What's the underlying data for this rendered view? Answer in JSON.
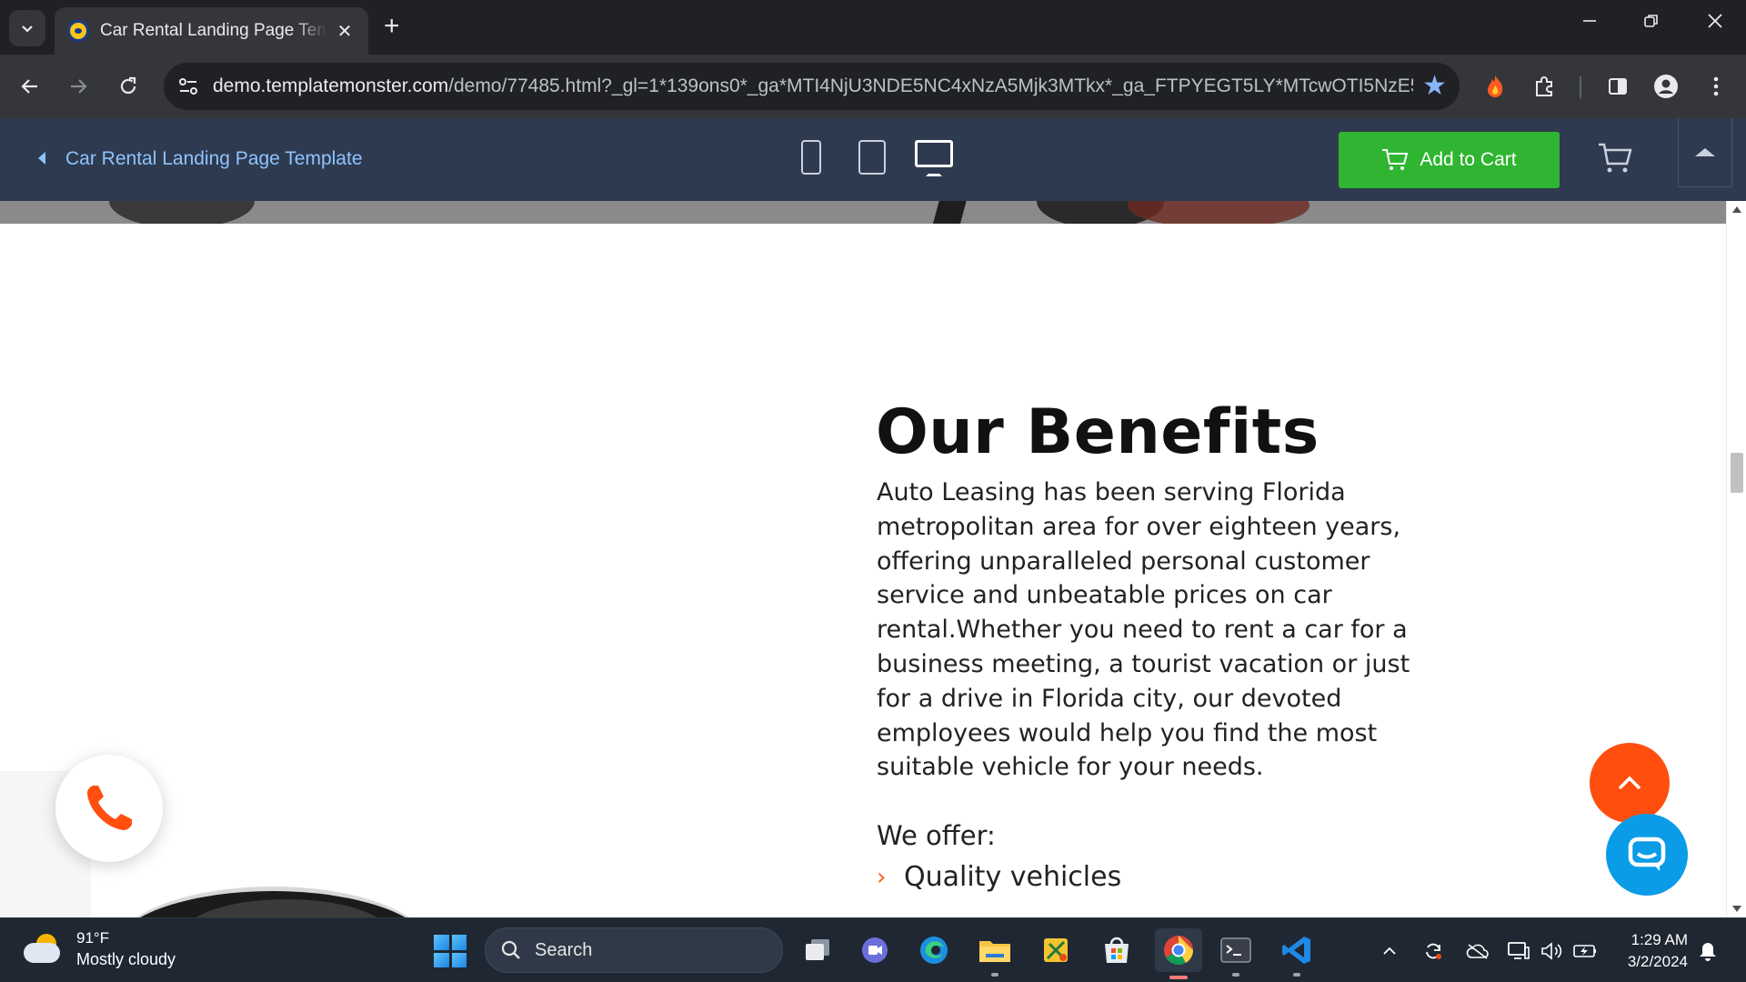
{
  "browser": {
    "tab_title": "Car Rental Landing Page Template",
    "tab_close": "✕",
    "new_tab": "+",
    "url_domain": "demo.templatemonster.com",
    "url_path": "/demo/77485.html?_gl=1*139ons0*_ga*MTI4NjU3NDE5NC4xNzA5Mjk3MTkx*_ga_FTPYEGT5LY*MTcwOTI5NzE5..."
  },
  "preview_bar": {
    "title": "Car Rental Landing Page Template",
    "add_to_cart": "Add to Cart",
    "accent_color": "#2fb532"
  },
  "page": {
    "heading": "Our Benefits",
    "paragraph": "Auto Leasing has been serving Florida metropolitan area for over eighteen years, offering unparalleled personal customer service and unbeatable prices on car rental.Whether you need to rent a car for a business meeting, a tourist vacation or just for a drive in Florida city, our devoted employees would help you find the most suitable vehicle for your needs.",
    "offer_title": "We offer:",
    "offer_items": [
      "Quality vehicles"
    ],
    "offer_bullet": "›",
    "accent_color": "#ff4e0e",
    "chat_color": "#0b9ce8"
  },
  "taskbar": {
    "weather_temp": "91°F",
    "weather_desc": "Mostly cloudy",
    "search_placeholder": "Search",
    "time": "1:29 AM",
    "date": "3/2/2024"
  },
  "icons": {
    "tab_search": "chevron-down-icon",
    "back": "arrow-left-icon",
    "forward": "arrow-right-icon",
    "reload": "reload-icon",
    "bookmark": "star-icon",
    "extensions": "puzzle-icon",
    "profile": "person-icon",
    "phone": "phone-icon",
    "chat": "chat-icon"
  }
}
